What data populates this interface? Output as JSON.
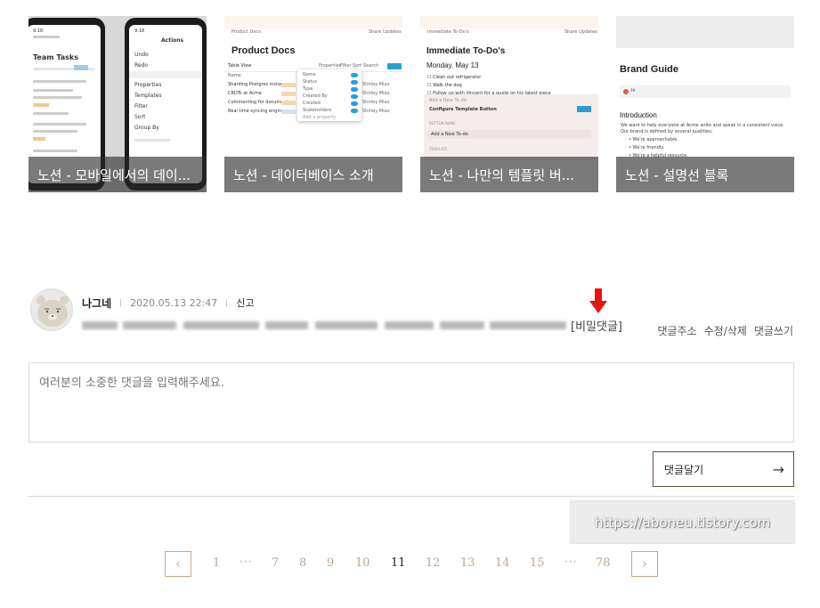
{
  "related_posts": [
    {
      "caption": "노션 - 모바일에서의 데이...",
      "thumb": {
        "left_title": "Team Tasks",
        "right_title": "Actions",
        "right_items": [
          "Undo",
          "Redo",
          "Properties",
          "Templates",
          "Filter",
          "Sort",
          "Group By"
        ]
      }
    },
    {
      "caption": "노션 - 데이터베이스 소개",
      "thumb": {
        "title": "Product Docs",
        "breadcrumb": "Product Docs",
        "share": "Share",
        "updates": "Updates",
        "view": "Table View",
        "toolbar": [
          "Properties",
          "Filter",
          "Sort",
          "Search"
        ],
        "new_label": "New",
        "rows": [
          "Sharding Postgres instances",
          "CRDTs at Acme",
          "Commenting for documents",
          "Real time syncing engine"
        ],
        "props": [
          "Name",
          "Status",
          "Type",
          "Created By",
          "Created",
          "Stakeholders"
        ],
        "add_prop": "Add a property",
        "owner": "Shirley Miao"
      }
    },
    {
      "caption": "노션 - 나만의 템플릿 버...",
      "thumb": {
        "breadcrumb": "Immediate To-Do's",
        "share": "Share",
        "updates": "Updates",
        "title": "Immediate To-Do's",
        "date": "Monday, May 13",
        "todos": [
          "Clean out refrigerator",
          "Walk the dog",
          "Follow up with Vincent for a quote on his latest piece"
        ],
        "add_new": "Add a New To-do",
        "configure": "Configure Template Button",
        "done": "Done",
        "button_name": "BUTTON NAME",
        "template": "TEMPLATE"
      }
    },
    {
      "caption": "노션 - 설명선 블록",
      "thumb": {
        "title": "Brand Guide",
        "callout": "hi",
        "heading": "Introduction",
        "body": "We want to help everyone at Acme write and speak in a consistent voice. Our brand is defined by several qualities:",
        "bullets": [
          "We're approachable.",
          "We're friendly.",
          "We're a helpful resource."
        ]
      }
    }
  ],
  "comment": {
    "author": "나그네",
    "date": "2020.05.13 22:47",
    "report": "신고",
    "secret_tag": "[비밀댓글]",
    "actions": [
      "댓글주소",
      "수정/삭제",
      "댓글쓰기"
    ],
    "arrow_color": "#e8140c"
  },
  "write": {
    "placeholder": "여러분의 소중한 댓글을 입력해주세요.",
    "submit_label": "댓글달기",
    "submit_arrow": "→"
  },
  "watermark": "https://aboneu.tistory.com",
  "pagination": {
    "prev": "‹",
    "next": "›",
    "items": [
      "1",
      "···",
      "7",
      "8",
      "9",
      "10",
      "11",
      "12",
      "13",
      "14",
      "15",
      "···",
      "78"
    ],
    "current": "11"
  },
  "colors": {
    "accent_brown": "#6b4f3a",
    "pager": "#c2a58e",
    "toggle_blue": "#2b9ed8"
  }
}
